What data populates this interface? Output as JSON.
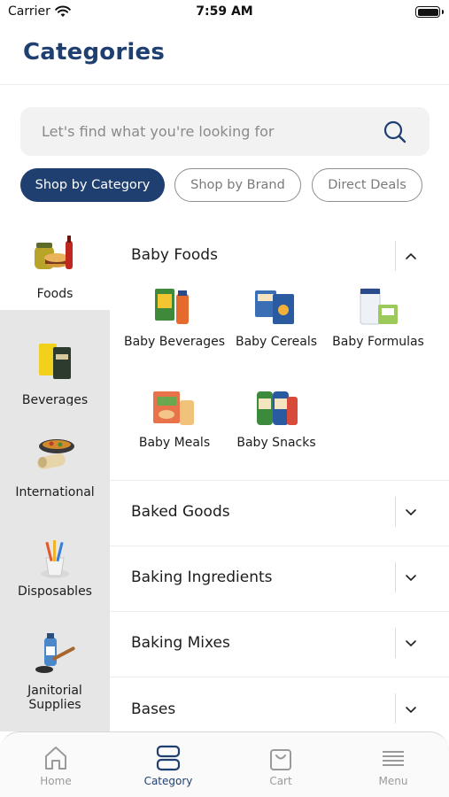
{
  "status_bar": {
    "carrier": "Carrier",
    "time": "7:59 AM"
  },
  "header": {
    "title": "Categories"
  },
  "search": {
    "placeholder": "Let's find what you're looking for"
  },
  "chips": [
    {
      "label": "Shop by Category",
      "active": true
    },
    {
      "label": "Shop by Brand",
      "active": false
    },
    {
      "label": "Direct Deals",
      "active": false
    }
  ],
  "sidebar": {
    "items": [
      {
        "label": "Foods",
        "icon": "foods-image",
        "selected": true
      },
      {
        "label": "Beverages",
        "icon": "beverages-image",
        "selected": false
      },
      {
        "label": "International Foods",
        "icon": "international-foods-image",
        "selected": false
      },
      {
        "label": "Disposables",
        "icon": "disposables-image",
        "selected": false
      },
      {
        "label": "Janitorial Supplies",
        "icon": "janitorial-image",
        "selected": false
      }
    ]
  },
  "sections": [
    {
      "title": "Baby Foods",
      "expanded": true,
      "subcategories": [
        {
          "label": "Baby Beverages",
          "icon": "baby-beverages-image"
        },
        {
          "label": "Baby Cereals",
          "icon": "baby-cereals-image"
        },
        {
          "label": "Baby Formulas",
          "icon": "baby-formulas-image"
        },
        {
          "label": "Baby Meals",
          "icon": "baby-meals-image"
        },
        {
          "label": "Baby Snacks",
          "icon": "baby-snacks-image"
        }
      ]
    },
    {
      "title": "Baked Goods",
      "expanded": false
    },
    {
      "title": "Baking Ingredients",
      "expanded": false
    },
    {
      "title": "Baking Mixes",
      "expanded": false
    },
    {
      "title": "Bases",
      "expanded": false
    }
  ],
  "tab_bar": {
    "tabs": [
      {
        "label": "Home",
        "icon": "home-icon",
        "active": false
      },
      {
        "label": "Category",
        "icon": "category-icon",
        "active": true
      },
      {
        "label": "Cart",
        "icon": "cart-icon",
        "active": false
      },
      {
        "label": "Menu",
        "icon": "menu-icon",
        "active": false
      }
    ]
  },
  "colors": {
    "brand": "#1e3f6f",
    "sidebar_bg": "#e6e6e6",
    "inactive": "#9a9a9a"
  }
}
